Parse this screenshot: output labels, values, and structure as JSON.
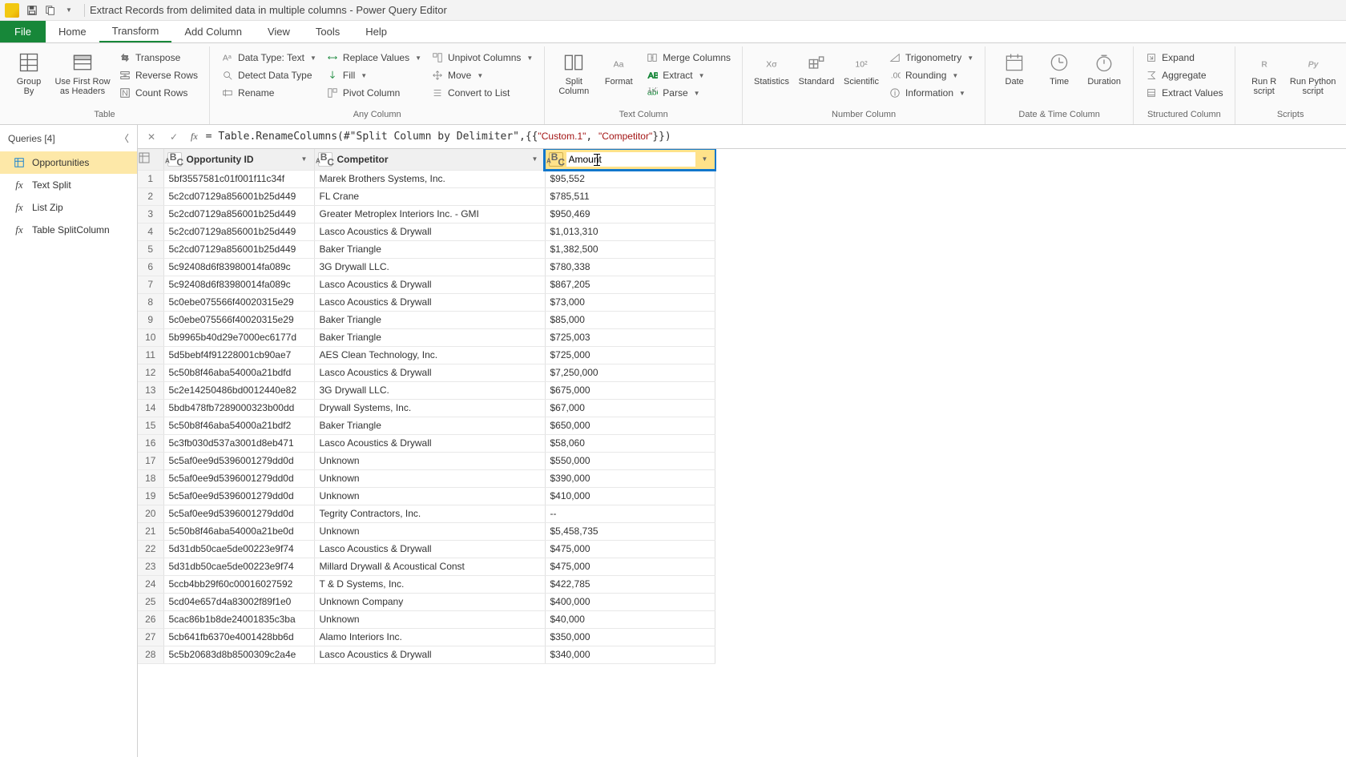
{
  "window": {
    "title": "Extract Records from delimited data in multiple columns - Power Query Editor"
  },
  "menu": {
    "file": "File",
    "items": [
      "Home",
      "Transform",
      "Add Column",
      "View",
      "Tools",
      "Help"
    ]
  },
  "ribbon": {
    "groups": {
      "table": {
        "label": "Table",
        "group_by": "Group\nBy",
        "use_first_row": "Use First Row\nas Headers",
        "transpose": "Transpose",
        "reverse_rows": "Reverse Rows",
        "count_rows": "Count Rows"
      },
      "any_column": {
        "label": "Any Column",
        "data_type": "Data Type: Text",
        "detect": "Detect Data Type",
        "rename": "Rename",
        "replace": "Replace Values",
        "fill": "Fill",
        "pivot": "Pivot Column",
        "unpivot": "Unpivot Columns",
        "move": "Move",
        "convert_list": "Convert to List"
      },
      "text_column": {
        "label": "Text Column",
        "split": "Split\nColumn",
        "format": "Format",
        "merge": "Merge Columns",
        "extract": "Extract",
        "parse": "Parse"
      },
      "number_column": {
        "label": "Number Column",
        "statistics": "Statistics",
        "standard": "Standard",
        "scientific": "Scientific",
        "trig": "Trigonometry",
        "rounding": "Rounding",
        "information": "Information"
      },
      "date_time": {
        "label": "Date & Time Column",
        "date": "Date",
        "time": "Time",
        "duration": "Duration"
      },
      "structured": {
        "label": "Structured Column",
        "expand": "Expand",
        "aggregate": "Aggregate",
        "extract_values": "Extract Values"
      },
      "scripts": {
        "label": "Scripts",
        "run_r": "Run R\nscript",
        "run_py": "Run Python\nscript"
      }
    }
  },
  "queries": {
    "header": "Queries [4]",
    "items": [
      {
        "name": "Opportunities",
        "kind": "table",
        "selected": true
      },
      {
        "name": "Text Split",
        "kind": "fx",
        "selected": false
      },
      {
        "name": "List Zip",
        "kind": "fx",
        "selected": false
      },
      {
        "name": "Table SplitColumn",
        "kind": "fx",
        "selected": false
      }
    ]
  },
  "formula": {
    "prefix": "= Table.RenameColumns(#\"Split Column by Delimiter\",{{",
    "str1": "\"Custom.1\"",
    "mid": ", ",
    "str2": "\"Competitor\"",
    "suffix": "}})"
  },
  "columns": [
    {
      "name": "Opportunity ID",
      "editing": false
    },
    {
      "name": "Competitor",
      "editing": false
    },
    {
      "name": "Amount",
      "editing": true
    }
  ],
  "rows": [
    {
      "n": 1,
      "id": "5bf3557581c01f001f11c34f",
      "comp": "Marek Brothers Systems, Inc.",
      "amt": "$95,552"
    },
    {
      "n": 2,
      "id": "5c2cd07129a856001b25d449",
      "comp": "FL Crane",
      "amt": "$785,511"
    },
    {
      "n": 3,
      "id": "5c2cd07129a856001b25d449",
      "comp": "Greater Metroplex Interiors  Inc. - GMI",
      "amt": "$950,469"
    },
    {
      "n": 4,
      "id": "5c2cd07129a856001b25d449",
      "comp": "Lasco Acoustics & Drywall",
      "amt": "$1,013,310"
    },
    {
      "n": 5,
      "id": "5c2cd07129a856001b25d449",
      "comp": "Baker Triangle",
      "amt": "$1,382,500"
    },
    {
      "n": 6,
      "id": "5c92408d6f83980014fa089c",
      "comp": "3G Drywall LLC.",
      "amt": "$780,338"
    },
    {
      "n": 7,
      "id": "5c92408d6f83980014fa089c",
      "comp": "Lasco Acoustics & Drywall",
      "amt": "$867,205"
    },
    {
      "n": 8,
      "id": "5c0ebe075566f40020315e29",
      "comp": "Lasco Acoustics & Drywall",
      "amt": "$73,000"
    },
    {
      "n": 9,
      "id": "5c0ebe075566f40020315e29",
      "comp": "Baker Triangle",
      "amt": "$85,000"
    },
    {
      "n": 10,
      "id": "5b9965b40d29e7000ec6177d",
      "comp": "Baker Triangle",
      "amt": "$725,003"
    },
    {
      "n": 11,
      "id": "5d5bebf4f91228001cb90ae7",
      "comp": "AES Clean Technology, Inc.",
      "amt": "$725,000"
    },
    {
      "n": 12,
      "id": "5c50b8f46aba54000a21bdfd",
      "comp": "Lasco Acoustics & Drywall",
      "amt": "$7,250,000"
    },
    {
      "n": 13,
      "id": "5c2e14250486bd0012440e82",
      "comp": "3G Drywall LLC.",
      "amt": "$675,000"
    },
    {
      "n": 14,
      "id": "5bdb478fb7289000323b00dd",
      "comp": "Drywall Systems, Inc.",
      "amt": "$67,000"
    },
    {
      "n": 15,
      "id": "5c50b8f46aba54000a21bdf2",
      "comp": "Baker Triangle",
      "amt": "$650,000"
    },
    {
      "n": 16,
      "id": "5c3fb030d537a3001d8eb471",
      "comp": "Lasco Acoustics & Drywall",
      "amt": "$58,060"
    },
    {
      "n": 17,
      "id": "5c5af0ee9d5396001279dd0d",
      "comp": "Unknown",
      "amt": "$550,000"
    },
    {
      "n": 18,
      "id": "5c5af0ee9d5396001279dd0d",
      "comp": "Unknown",
      "amt": "$390,000"
    },
    {
      "n": 19,
      "id": "5c5af0ee9d5396001279dd0d",
      "comp": "Unknown",
      "amt": "$410,000"
    },
    {
      "n": 20,
      "id": "5c5af0ee9d5396001279dd0d",
      "comp": "Tegrity Contractors, Inc.",
      "amt": "--"
    },
    {
      "n": 21,
      "id": "5c50b8f46aba54000a21be0d",
      "comp": "Unknown",
      "amt": "$5,458,735"
    },
    {
      "n": 22,
      "id": "5d31db50cae5de00223e9f74",
      "comp": "Lasco Acoustics & Drywall",
      "amt": "$475,000"
    },
    {
      "n": 23,
      "id": "5d31db50cae5de00223e9f74",
      "comp": "Millard Drywall & Acoustical Const",
      "amt": "$475,000"
    },
    {
      "n": 24,
      "id": "5ccb4bb29f60c00016027592",
      "comp": "T & D Systems, Inc.",
      "amt": "$422,785"
    },
    {
      "n": 25,
      "id": "5cd04e657d4a83002f89f1e0",
      "comp": "Unknown Company",
      "amt": "$400,000"
    },
    {
      "n": 26,
      "id": "5cac86b1b8de24001835c3ba",
      "comp": "Unknown",
      "amt": "$40,000"
    },
    {
      "n": 27,
      "id": "5cb641fb6370e4001428bb6d",
      "comp": "Alamo Interiors Inc.",
      "amt": "$350,000"
    },
    {
      "n": 28,
      "id": "5c5b20683d8b8500309c2a4e",
      "comp": "Lasco Acoustics & Drywall",
      "amt": "$340,000"
    }
  ]
}
